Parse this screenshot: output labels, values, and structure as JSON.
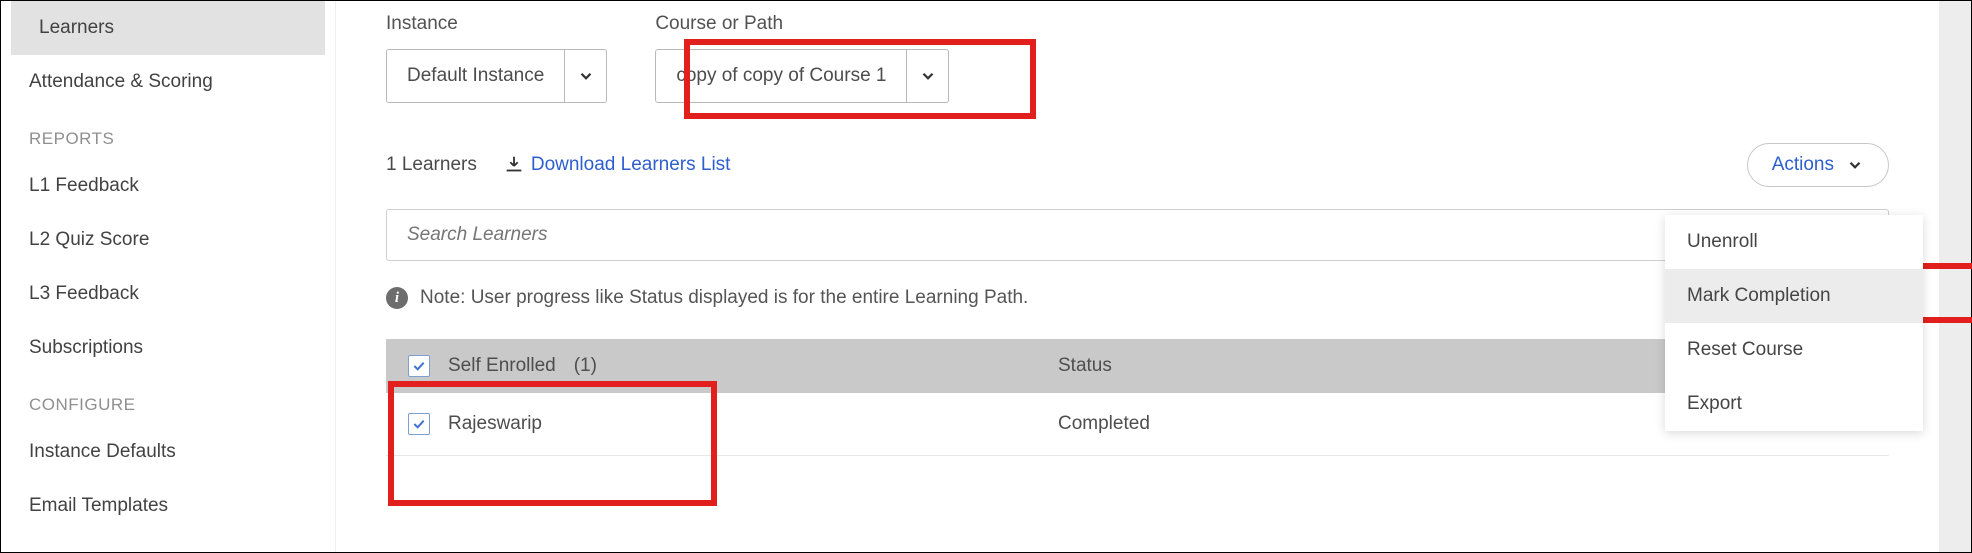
{
  "sidebar": {
    "items": [
      {
        "label": "Learners",
        "active": true
      },
      {
        "label": "Attendance & Scoring",
        "active": false
      }
    ],
    "reports_title": "REPORTS",
    "reports_items": [
      {
        "label": "L1 Feedback"
      },
      {
        "label": "L2 Quiz Score"
      },
      {
        "label": "L3 Feedback"
      },
      {
        "label": "Subscriptions"
      }
    ],
    "configure_title": "CONFIGURE",
    "configure_items": [
      {
        "label": "Instance Defaults"
      },
      {
        "label": "Email Templates"
      }
    ]
  },
  "filters": {
    "instance_label": "Instance",
    "instance_value": "Default Instance",
    "course_label": "Course or Path",
    "course_value": "copy of copy of Course 1"
  },
  "listbar": {
    "count_text": "1 Learners",
    "download_text": "Download Learners List",
    "actions_label": "Actions"
  },
  "search": {
    "placeholder": "Search Learners"
  },
  "note": {
    "text": "Note: User progress like Status displayed is for the entire Learning Path."
  },
  "table": {
    "group_label": "Self Enrolled",
    "group_count": "(1)",
    "status_header": "Status",
    "rows": [
      {
        "name": "Rajeswarip",
        "status": "Completed"
      }
    ]
  },
  "actions_menu": {
    "items": [
      {
        "label": "Unenroll"
      },
      {
        "label": "Mark Completion",
        "highlighted": true
      },
      {
        "label": "Reset Course"
      },
      {
        "label": "Export"
      }
    ]
  }
}
